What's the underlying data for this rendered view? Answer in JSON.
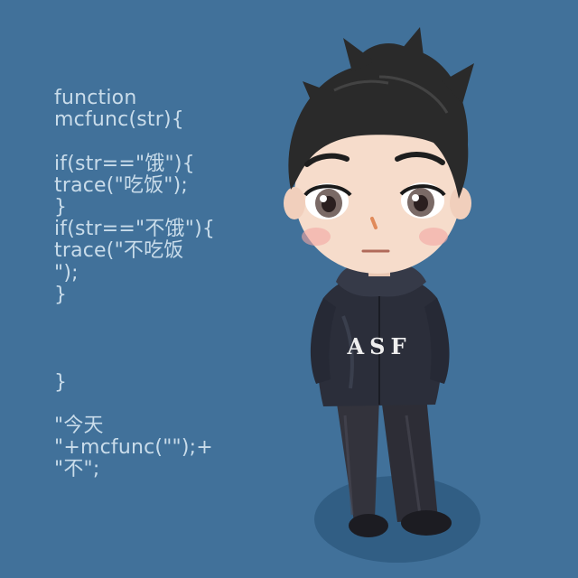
{
  "code": {
    "lines": [
      "function",
      "mcfunc(str){",
      "",
      "if(str==\"饿\"){",
      "trace(\"吃饭\");",
      "}",
      "if(str==\"不饿\"){",
      "trace(\"不吃饭",
      "\");",
      "}",
      "",
      "",
      "",
      "}",
      "",
      "\"今天",
      "\"+mcfunc(\"\");+",
      "\"不\";"
    ]
  },
  "character": {
    "jacket_text": "ASF"
  },
  "colors": {
    "background": "#41719a",
    "code_text": "#c9dcea",
    "jacket": "#2b2e3a",
    "hair": "#2a2a2a",
    "skin": "#f6dccb"
  }
}
